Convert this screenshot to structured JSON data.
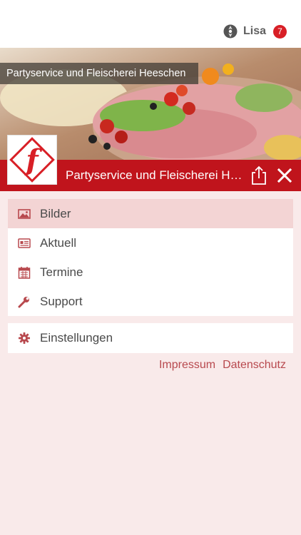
{
  "topbar": {
    "user_name": "Lisa",
    "notification_count": "7",
    "user_icon": "user-status-icon"
  },
  "hero": {
    "caption": "Partyservice und Fleischerei Heeschen",
    "image": "party-platter-photo"
  },
  "titlebar": {
    "title": "Partyservice und Fleischerei Heeschen",
    "share_icon": "share-icon",
    "close_icon": "close-icon"
  },
  "logo": {
    "name": "fleischerei-f-logo"
  },
  "menu": {
    "items": [
      {
        "label": "Bilder",
        "icon": "image-icon",
        "active": true
      },
      {
        "label": "Aktuell",
        "icon": "news-icon",
        "active": false
      },
      {
        "label": "Termine",
        "icon": "calendar-icon",
        "active": false
      },
      {
        "label": "Support",
        "icon": "wrench-icon",
        "active": false
      }
    ],
    "settings": {
      "label": "Einstellungen",
      "icon": "gear-icon"
    }
  },
  "footer": {
    "impressum": "Impressum",
    "datenschutz": "Datenschutz"
  },
  "colors": {
    "brand_red": "#c0141c",
    "background": "#f9eaea",
    "active_item": "#f3d4d4",
    "icon_red": "#b8494e"
  }
}
